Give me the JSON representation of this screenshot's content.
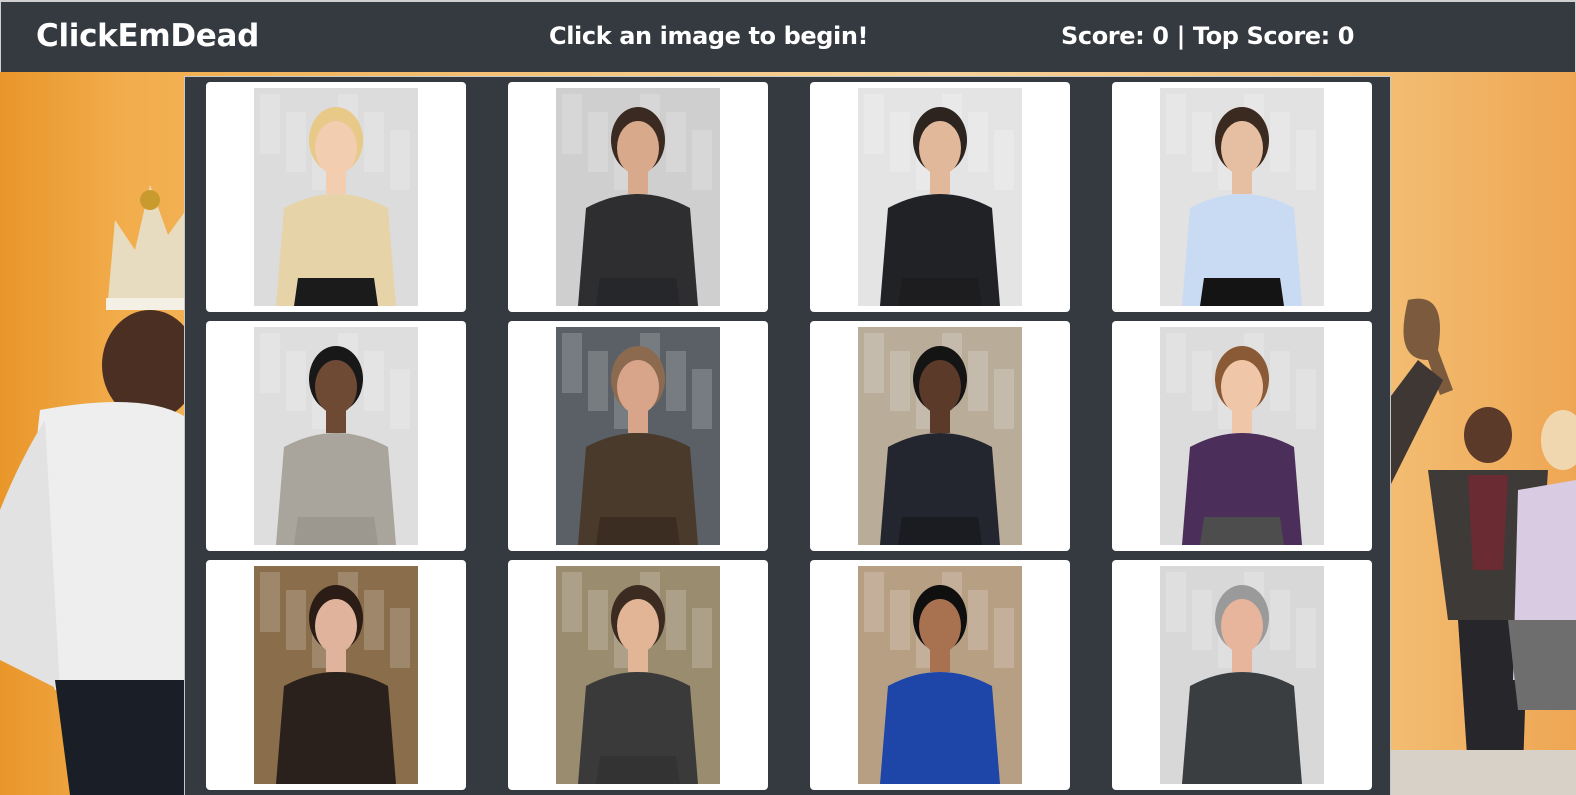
{
  "navbar": {
    "brand": "ClickEmDead",
    "message": "Click an image to begin!",
    "score_label": "Score:",
    "score": 0,
    "separator": "|",
    "top_score_label": "Top Score:",
    "top_score": 0
  },
  "colors": {
    "navbar_bg": "#343a40",
    "panel_bg": "#343a40",
    "card_bg": "#ffffff",
    "page_bg": "#f2ad4c"
  },
  "cards": [
    {
      "bg": "#dcdcdc",
      "shirt": "#e6d3a8",
      "hair": "#e8c987",
      "skin": "#f2cdb0",
      "pants": "#1b1b1b"
    },
    {
      "bg": "#cfcfcf",
      "shirt": "#2e2e31",
      "hair": "#3a2a22",
      "skin": "#d9a98b",
      "pants": "#25272b"
    },
    {
      "bg": "#e4e4e4",
      "shirt": "#202226",
      "hair": "#2d2420",
      "skin": "#e2b89a",
      "pants": "#1d1d20"
    },
    {
      "bg": "#e2e2e2",
      "shirt": "#c9daf3",
      "hair": "#3b2a20",
      "skin": "#e6bfa2",
      "pants": "#141414"
    },
    {
      "bg": "#dedede",
      "shirt": "#a9a59c",
      "hair": "#181818",
      "skin": "#6e4a35",
      "pants": "#9c988f"
    },
    {
      "bg": "#5a6065",
      "shirt": "#4a3a2c",
      "hair": "#8b6a4f",
      "skin": "#d8a48a",
      "pants": "#3b2d22"
    },
    {
      "bg": "#b9ad9a",
      "shirt": "#23262e",
      "hair": "#141414",
      "skin": "#5c3a2a",
      "pants": "#1b1c22"
    },
    {
      "bg": "#dcdcdc",
      "shirt": "#4b2f5a",
      "hair": "#8a5a36",
      "skin": "#efc6a8",
      "pants": "#4d4d4d"
    },
    {
      "bg": "#8a6d4b",
      "shirt": "#2a211c",
      "hair": "#2b1d16",
      "skin": "#e0b49c",
      "pants": "#2a211c"
    },
    {
      "bg": "#9a8c6f",
      "shirt": "#3a3a3a",
      "hair": "#3b2b20",
      "skin": "#e2b596",
      "pants": "#333"
    },
    {
      "bg": "#b79f84",
      "shirt": "#1e46a8",
      "hair": "#0f0f0f",
      "skin": "#a8714f",
      "pants": "#1e46a8"
    },
    {
      "bg": "#d8d8d8",
      "shirt": "#3a3e40",
      "hair": "#9a9a9a",
      "skin": "#e7b59c",
      "pants": "#3a3e40"
    }
  ]
}
